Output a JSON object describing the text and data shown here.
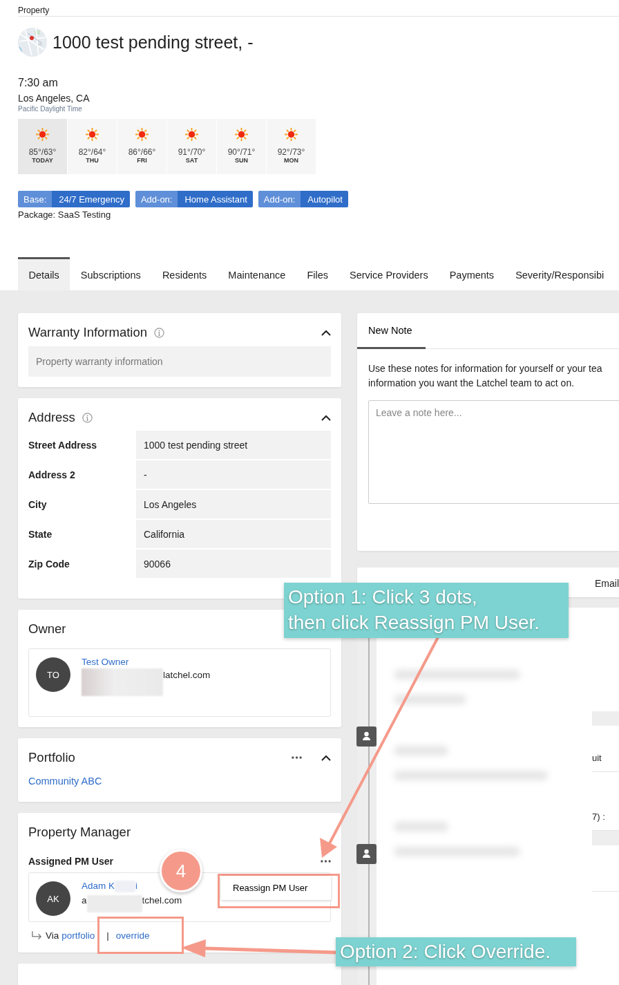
{
  "breadcrumb": "Property",
  "title": "1000 test pending street, -",
  "local_time": {
    "time": "7:30 am",
    "city": "Los Angeles, CA",
    "timezone": "Pacific Daylight Time"
  },
  "forecast": [
    {
      "temps": "85°/63°",
      "day": "TODAY",
      "selected": true
    },
    {
      "temps": "82°/64°",
      "day": "THU",
      "selected": false
    },
    {
      "temps": "86°/66°",
      "day": "FRI",
      "selected": false
    },
    {
      "temps": "91°/70°",
      "day": "SAT",
      "selected": false
    },
    {
      "temps": "90°/71°",
      "day": "SUN",
      "selected": false
    },
    {
      "temps": "92°/73°",
      "day": "MON",
      "selected": false
    }
  ],
  "plans": [
    {
      "label": "Base:",
      "value": "24/7 Emergency"
    },
    {
      "label": "Add-on:",
      "value": "Home Assistant"
    },
    {
      "label": "Add-on:",
      "value": "Autopilot"
    }
  ],
  "package": "Package: SaaS Testing",
  "tabs": [
    {
      "label": "Details",
      "selected": true
    },
    {
      "label": "Subscriptions",
      "selected": false
    },
    {
      "label": "Residents",
      "selected": false
    },
    {
      "label": "Maintenance",
      "selected": false
    },
    {
      "label": "Files",
      "selected": false
    },
    {
      "label": "Service Providers",
      "selected": false
    },
    {
      "label": "Payments",
      "selected": false
    },
    {
      "label": "Severity/Responsibi",
      "selected": false
    }
  ],
  "warranty": {
    "title": "Warranty Information",
    "placeholder": "Property warranty information"
  },
  "address": {
    "title": "Address",
    "fields": [
      {
        "label": "Street Address",
        "value": "1000 test pending street"
      },
      {
        "label": "Address 2",
        "value": "-"
      },
      {
        "label": "City",
        "value": "Los Angeles"
      },
      {
        "label": "State",
        "value": "California"
      },
      {
        "label": "Zip Code",
        "value": "90066"
      }
    ]
  },
  "owner": {
    "title": "Owner",
    "initials": "TO",
    "name": "Test Owner",
    "email_end": "latchel.com"
  },
  "portfolio": {
    "title": "Portfolio",
    "link": "Community ABC"
  },
  "property_manager": {
    "title": "Property Manager",
    "subtitle": "Assigned PM User",
    "initials": "AK",
    "name_start": "Adam K",
    "name_end": "i",
    "email_start": "a",
    "email_end": "tchel.com",
    "via": "Via",
    "via_link": "portfolio",
    "separator": "|",
    "override": "override",
    "menu": [
      "Reassign PM User"
    ]
  },
  "note": {
    "tab": "New Note",
    "lines": [
      "Use these notes for information for yourself or your tea",
      "information you want the Latchel team to act on."
    ],
    "placeholder": "Leave a note here..."
  },
  "activity": {
    "tabs": [
      "Email"
    ],
    "fragments": [
      "uit",
      "7) :"
    ]
  },
  "annotations": {
    "step": "4",
    "callout_1": [
      "Option 1: Click 3 dots,",
      "then click Reassign PM User."
    ],
    "callout_2": "Option 2: Click Override."
  }
}
